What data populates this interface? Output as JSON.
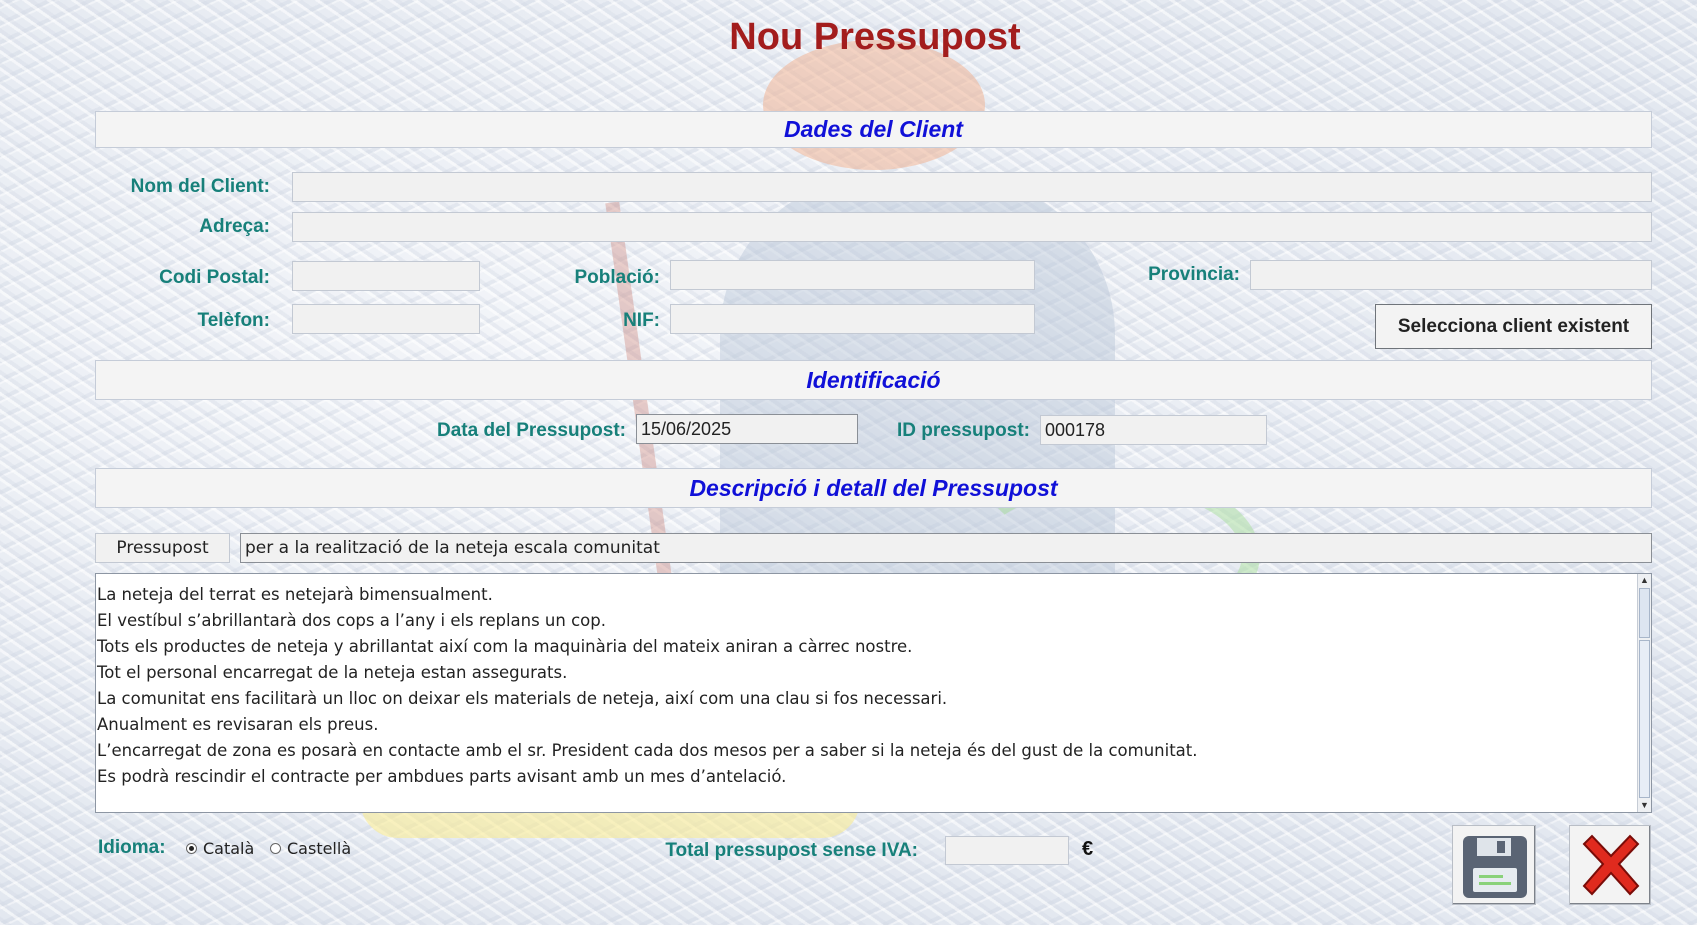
{
  "form": {
    "title": "Nou Pressupost",
    "client_section": {
      "heading": "Dades del Client",
      "name_label": "Nom del Client:",
      "name_value": "",
      "address_label": "Adreça:",
      "address_value": "",
      "postal_label": "Codi Postal:",
      "postal_value": "",
      "city_label": "Població:",
      "city_value": "",
      "province_label": "Provincia:",
      "province_value": "",
      "phone_label": "Telèfon:",
      "phone_value": "",
      "nif_label": "NIF:",
      "nif_value": "",
      "select_client_button": "Selecciona client existent"
    },
    "identification": {
      "heading": "Identificació",
      "date_label": "Data del Pressupost:",
      "date_value": "15/06/2025",
      "id_label": "ID pressupost:",
      "id_value": "000178"
    },
    "description": {
      "heading": "Descripció i detall del Pressupost",
      "prefix_label": "Pressupost",
      "subject_value": "per a la realització de la neteja escala comunitat",
      "lines": [
        "La neteja del terrat es netejarà bimensualment.",
        "El vestíbul s’abrillantarà dos cops a l’any i els replans un cop.",
        "Tots els productes de neteja y abrillantat així com la maquinària del mateix aniran a càrrec nostre.",
        "Tot el personal encarregat de la neteja estan assegurats.",
        "La comunitat ens facilitarà un lloc on deixar els materials de neteja, així com una clau si fos necessari.",
        "Anualment es revisaran els preus.",
        "L’encarregat de zona es posarà en contacte amb el sr. President cada dos mesos per a saber si la neteja és del gust de la comunitat.",
        "Es podrà rescindir el contracte per ambdues parts avisant amb un mes d’antelació."
      ]
    },
    "footer": {
      "language_label": "Idioma:",
      "language_options": [
        "Català",
        "Castellà"
      ],
      "language_selected": "Català",
      "total_label": "Total pressupost sense IVA:",
      "total_value": "",
      "currency_symbol": "€",
      "save_icon": "floppy-disk-icon",
      "close_icon": "red-x-icon"
    },
    "colors": {
      "title": "#a31d1d",
      "section_heading": "#1010d8",
      "labels": "#17807a",
      "close_x": "#e02a1e",
      "floppy": "#5a6474"
    }
  }
}
